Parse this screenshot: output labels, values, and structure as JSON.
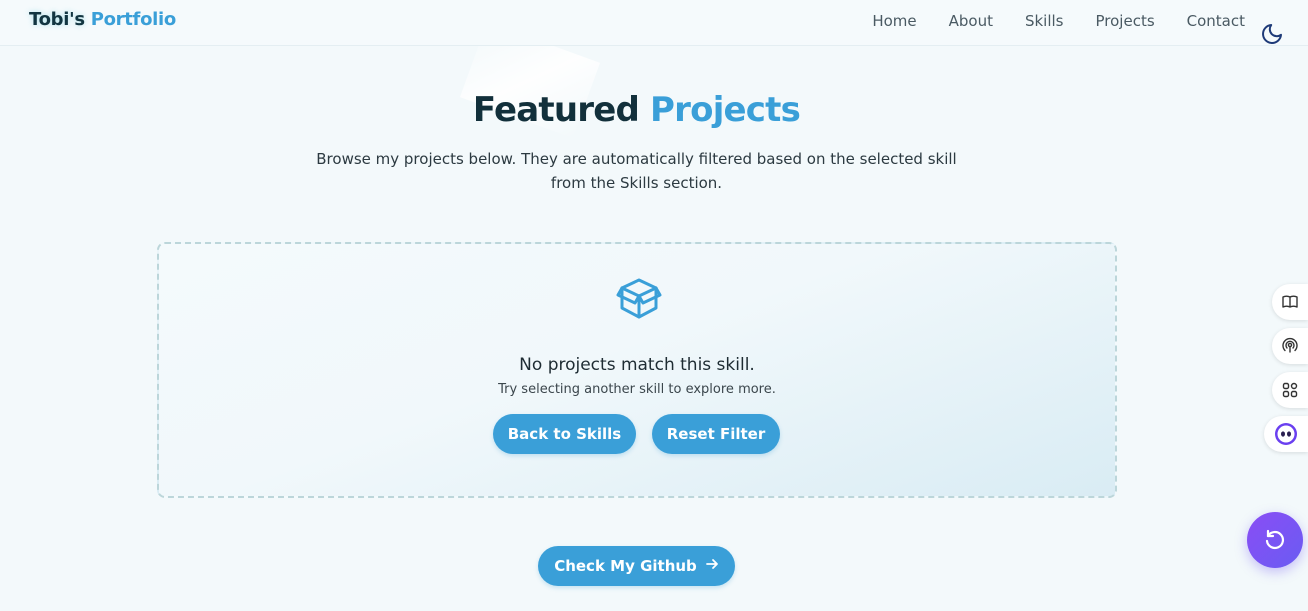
{
  "brand": {
    "first": "Tobi's",
    "second": "Portfolio"
  },
  "nav": {
    "items": [
      "Home",
      "About",
      "Skills",
      "Projects",
      "Contact"
    ]
  },
  "hero": {
    "title_part1": "Featured",
    "title_part2": "Projects",
    "subtitle": "Browse my projects below. They are automatically filtered based on the selected skill from the Skills section."
  },
  "empty_state": {
    "title": "No projects match this skill.",
    "hint": "Try selecting another skill to explore more.",
    "back_label": "Back to Skills",
    "reset_label": "Reset Filter"
  },
  "github_button": {
    "label": "Check My Github"
  },
  "colors": {
    "accent": "#3a9fd8",
    "brand_dark": "#12303b",
    "fab": "#8a4df5"
  },
  "icons": [
    "moon-icon",
    "package-icon",
    "arrow-right-icon",
    "book-icon",
    "broadcast-icon",
    "apps-icon",
    "bot-icon",
    "refresh-icon"
  ]
}
